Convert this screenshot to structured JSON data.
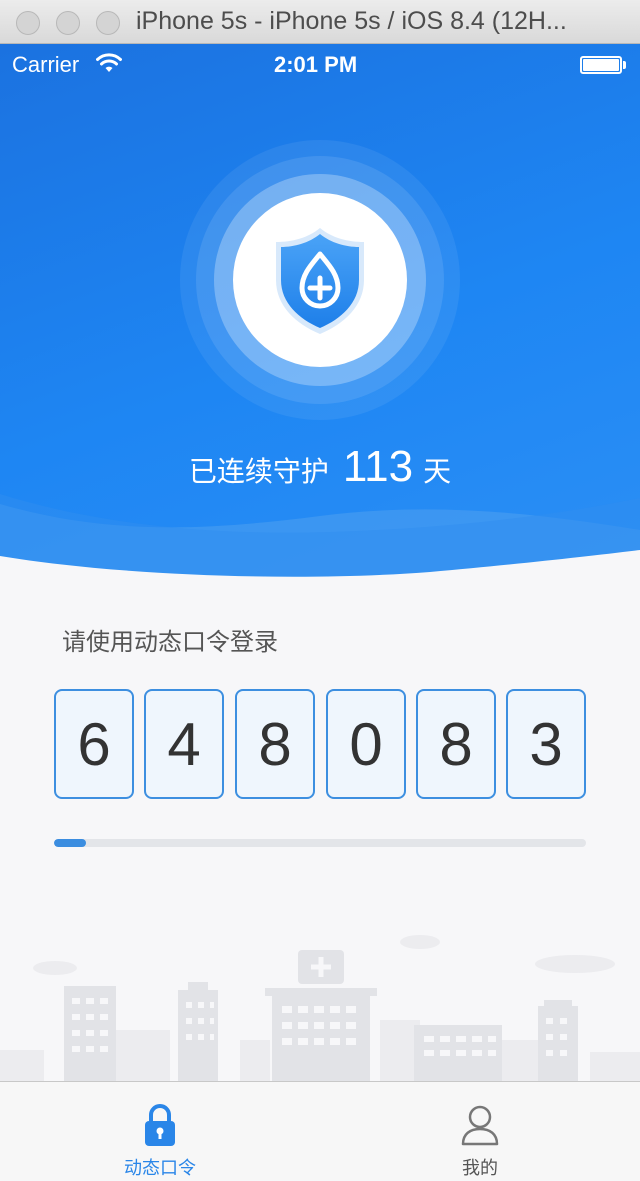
{
  "window": {
    "title": "iPhone 5s - iPhone 5s / iOS 8.4 (12H..."
  },
  "status_bar": {
    "carrier": "Carrier",
    "time": "2:01 PM"
  },
  "header": {
    "icon": "shield-plus-icon",
    "days_prefix": "已连续守护",
    "days_count": "113",
    "days_suffix": "天"
  },
  "login": {
    "prompt": "请使用动态口令登录",
    "code_digits": [
      "6",
      "4",
      "8",
      "0",
      "8",
      "3"
    ],
    "time_progress": 0.06
  },
  "tab_bar": {
    "tabs": [
      {
        "label": "动态口令",
        "icon": "lock-icon",
        "active": true
      },
      {
        "label": "我的",
        "icon": "person-icon",
        "active": false
      }
    ]
  },
  "colors": {
    "brand_blue": "#1e86f3",
    "accent": "#2a86e8",
    "digit_border": "#3d8fe0"
  }
}
